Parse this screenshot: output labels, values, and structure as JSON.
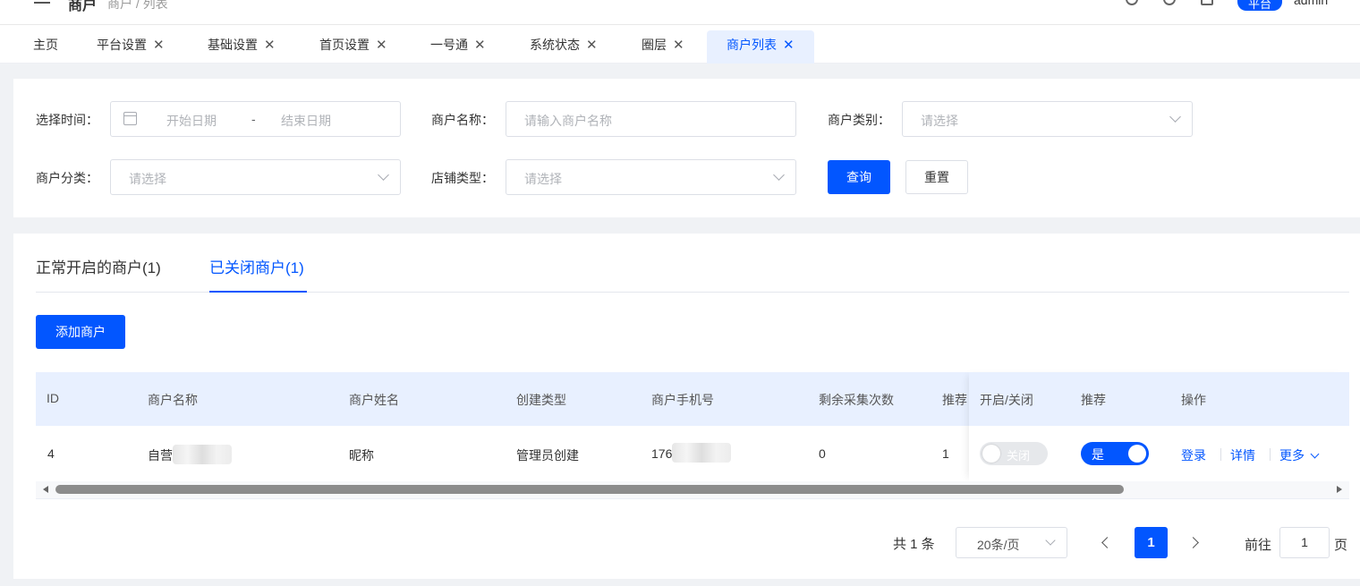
{
  "header": {
    "crumb_main": "商户",
    "crumb_sub": "商户 / 列表",
    "user_button": "平台",
    "user_name": "admin"
  },
  "tabs": [
    {
      "label": "主页",
      "closable": false
    },
    {
      "label": "平台设置",
      "closable": true
    },
    {
      "label": "基础设置",
      "closable": true
    },
    {
      "label": "首页设置",
      "closable": true
    },
    {
      "label": "一号通",
      "closable": true
    },
    {
      "label": "系统状态",
      "closable": true
    },
    {
      "label": "圈层",
      "closable": true
    },
    {
      "label": "商户列表",
      "closable": true,
      "active": true
    }
  ],
  "tab_close_glyph": "✕",
  "filters": {
    "time_label": "选择时间：",
    "start_placeholder": "开始日期",
    "date_sep": "-",
    "end_placeholder": "结束日期",
    "name_label": "商户名称：",
    "name_placeholder": "请输入商户名称",
    "category_label": "商户类别：",
    "category_placeholder": "请选择",
    "class_label": "商户分类：",
    "class_placeholder": "请选择",
    "store_type_label": "店铺类型：",
    "store_type_placeholder": "请选择",
    "query_button": "查询",
    "reset_button": "重置"
  },
  "status_tabs": {
    "open": "正常开启的商户(1)",
    "closed": "已关闭商户(1)"
  },
  "add_button": "添加商户",
  "table": {
    "columns": [
      "ID",
      "商户名称",
      "商户姓名",
      "创建类型",
      "商户手机号",
      "剩余采集次数",
      "推荐"
    ],
    "fixed_columns": [
      "开启/关闭",
      "推荐",
      "操作"
    ],
    "rows": [
      {
        "id": "4",
        "name": "自营",
        "real_name": "昵称",
        "create_type": "管理员创建",
        "phone": "176",
        "remaining": "0",
        "recommend_num": "1",
        "switch_text": "关闭",
        "recommend_text": "是",
        "actions": {
          "login": "登录",
          "detail": "详情",
          "more": "更多"
        }
      }
    ]
  },
  "pagination": {
    "total": "共 1 条",
    "page_size": "20条/页",
    "current": "1",
    "goto_label": "前往",
    "goto_value": "1",
    "page_unit": "页"
  },
  "colors": {
    "primary": "#0256ff",
    "header_bg": "#e8f0ff"
  }
}
